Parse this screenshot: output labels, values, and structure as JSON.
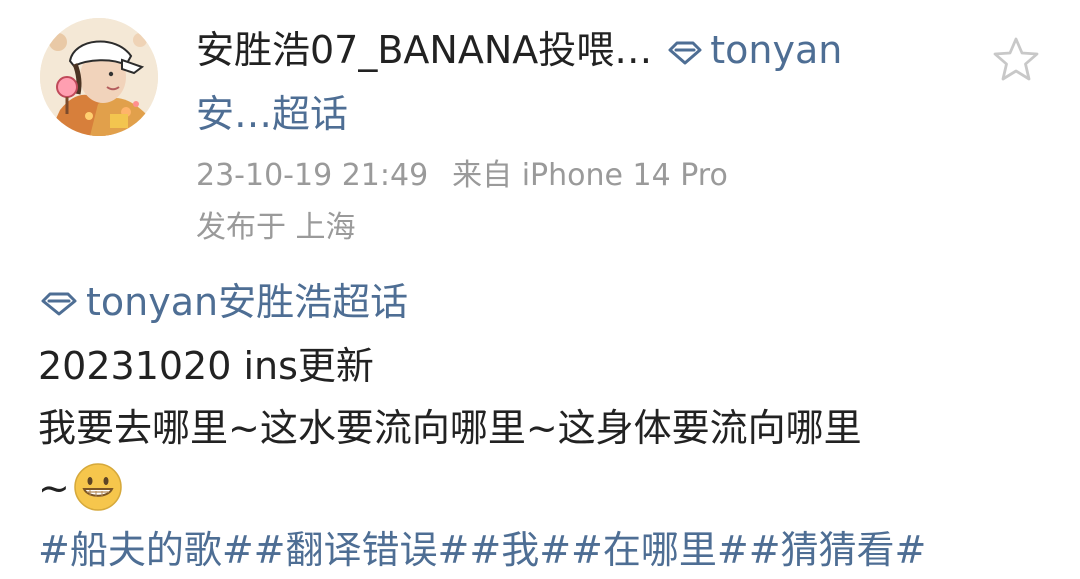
{
  "post": {
    "author": {
      "name": "安胜浩07_BANANA投喂…"
    },
    "header_topic": {
      "icon": "diamond-icon",
      "line1": "tonyan",
      "line2": "安…超话"
    },
    "meta": {
      "timestamp": "23-10-19 21:49",
      "source": "来自 iPhone 14 Pro",
      "location": "发布于 上海"
    },
    "body": {
      "topic_tag": "tonyan安胜浩超话",
      "line1": "20231020 ins更新",
      "line2": "我要去哪里~这水要流向哪里~这身体要流向哪里",
      "line3": "~",
      "emoji": "grinning-face-emoji",
      "hashtags": "#船夫的歌##翻译错误##我##在哪里##猜猜看#"
    },
    "actions": {
      "favorite_icon": "star-outline-icon"
    }
  },
  "colors": {
    "link": "#4e6e94",
    "text": "#222222",
    "meta": "#9a9a9a"
  }
}
